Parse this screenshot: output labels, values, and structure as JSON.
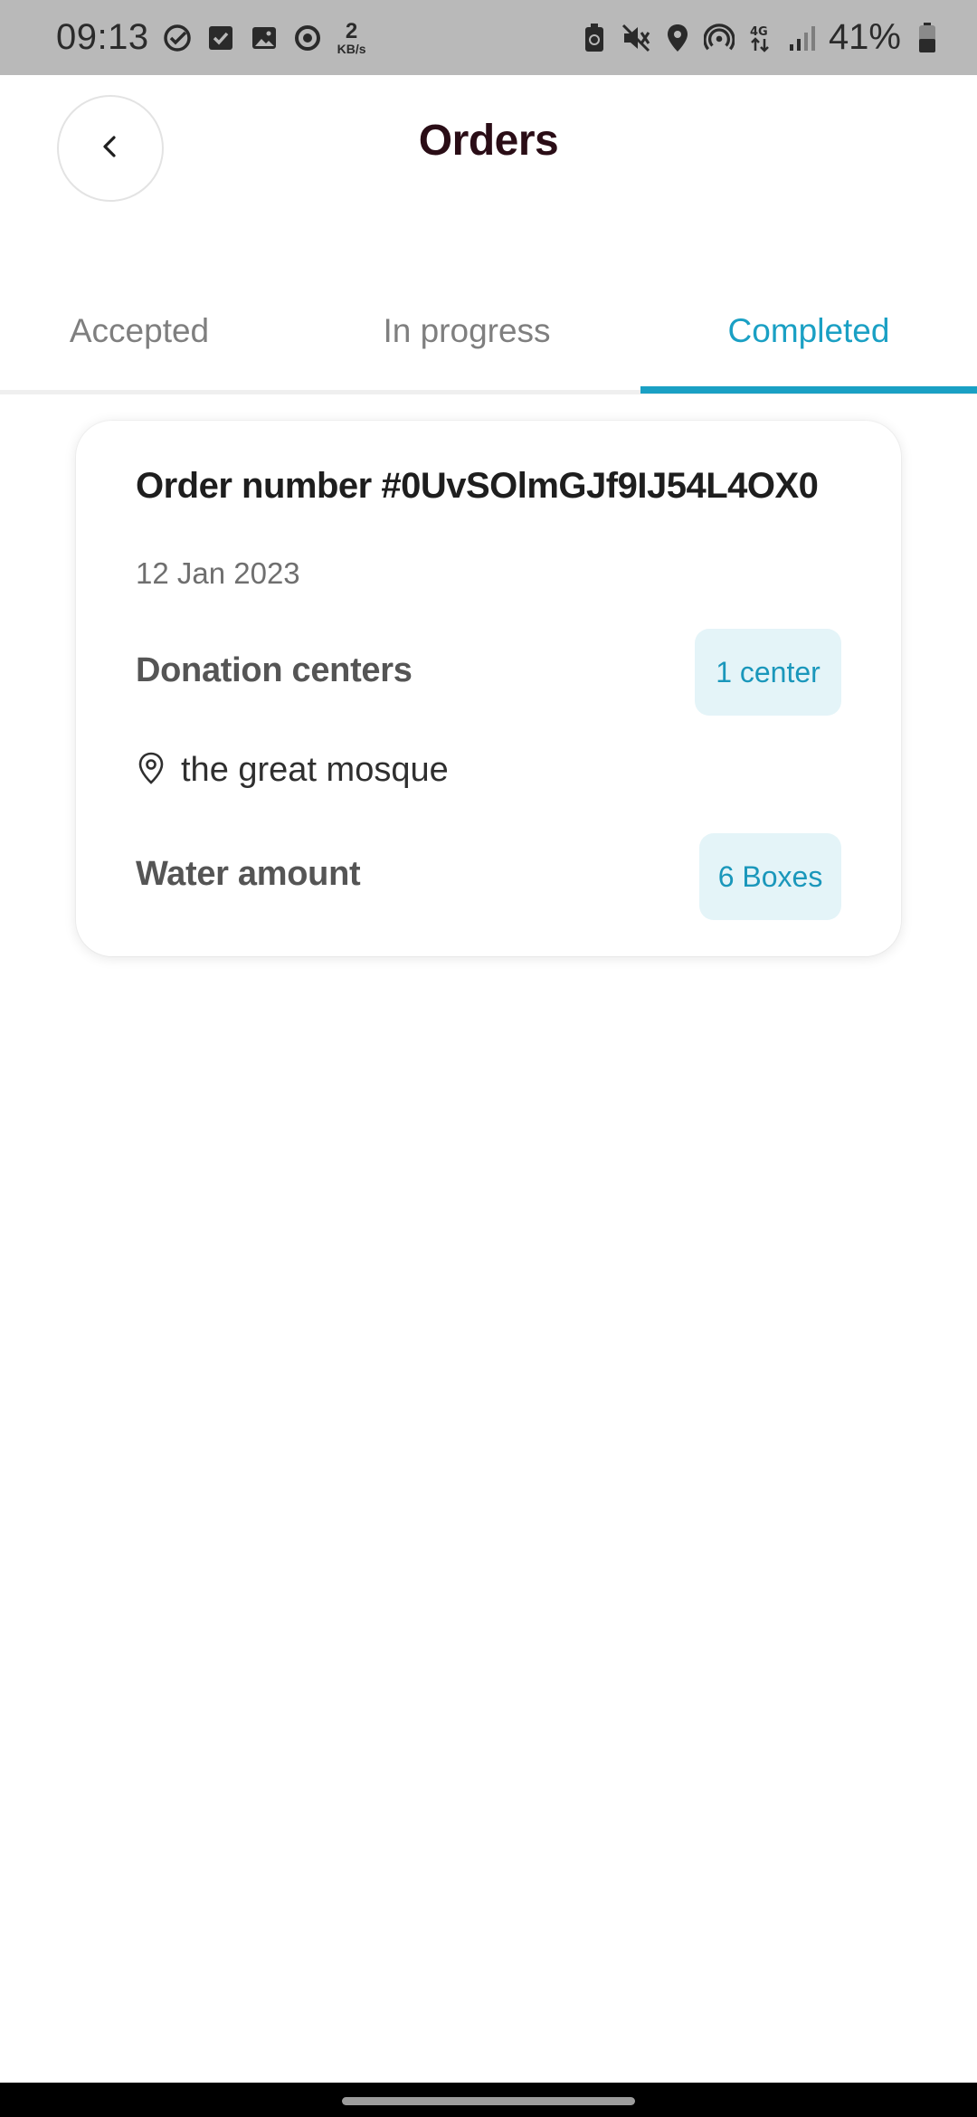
{
  "status_bar": {
    "time": "09:13",
    "net_speed_value": "2",
    "net_speed_unit": "KB/s",
    "battery_percent": "41%",
    "network_type": "4G",
    "icons_left": [
      "check-circle-icon",
      "checkbox-icon",
      "gallery-icon",
      "sync-icon"
    ],
    "icons_right": [
      "recycle-battery-icon",
      "mute-icon",
      "location-icon",
      "hotspot-icon",
      "4g-icon",
      "signal-icon",
      "battery-icon"
    ]
  },
  "header": {
    "title": "Orders",
    "back_icon": "chevron-left-icon"
  },
  "tabs": [
    {
      "label": "Accepted",
      "active": false
    },
    {
      "label": "In progress",
      "active": false
    },
    {
      "label": "Completed",
      "active": true
    }
  ],
  "orders": [
    {
      "number": "Order number #0UvSOlmGJf9IJ54L4OX0",
      "date": "12 Jan 2023",
      "centers_label": "Donation centers",
      "centers_badge": "1 center",
      "location_icon": "location-pin-icon",
      "location": "the great mosque",
      "water_label": "Water amount",
      "water_badge": "6 Boxes"
    }
  ],
  "colors": {
    "accent": "#1aa0c4",
    "badge_bg": "#e4f4f8",
    "title": "#2a0d16",
    "status_bar_bg": "#b9b9b9"
  }
}
